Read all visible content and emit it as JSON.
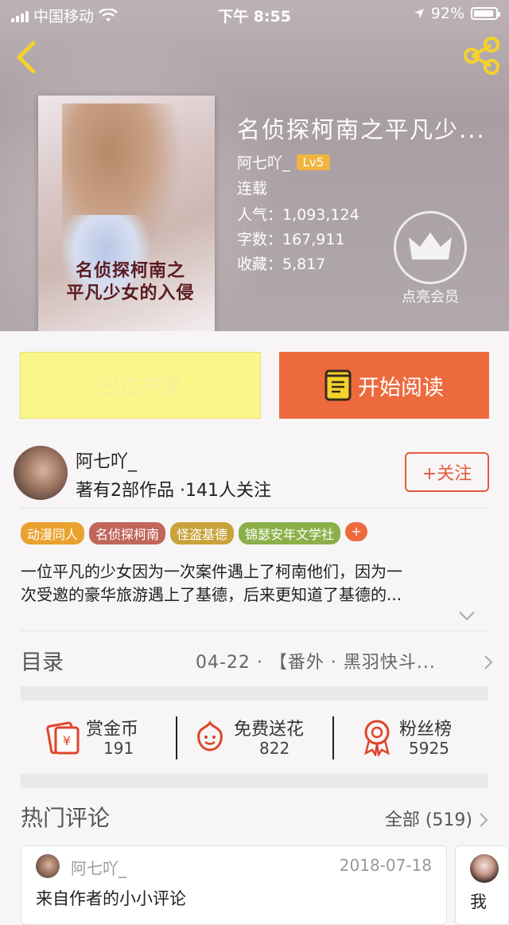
{
  "status_bar": {
    "carrier": "中国移动",
    "time": "下午 8:55",
    "battery": "92%",
    "battery_level": 0.92
  },
  "book": {
    "title": "名侦探柯南之平凡少...",
    "author": "阿七吖_",
    "level": "Lv5",
    "state": "连载",
    "popularity": "人气：1,093,124",
    "word_count": "字数：167,911",
    "favorites": "收藏：5,817",
    "cover_title_line1": "名侦探柯南之",
    "cover_title_line2": "平凡少女的入侵"
  },
  "vip": {
    "label": "点亮会员",
    "icon": "crown-icon"
  },
  "actions": {
    "shelf_label": "已在书架",
    "read_label": "开始阅读"
  },
  "author_info": {
    "name": "阿七吖_",
    "stats": "著有2部作品 ·141人关注",
    "follow_label": "+关注"
  },
  "tags": [
    {
      "label": "动漫同人",
      "color": "#e9a22e"
    },
    {
      "label": "名侦探柯南",
      "color": "#c0665a"
    },
    {
      "label": "怪盗基德",
      "color": "#c8a23a"
    },
    {
      "label": "锦瑟安年文学社",
      "color": "#8bb04a"
    }
  ],
  "tag_add": "+",
  "summary": {
    "line1": "一位平凡的少女因为一次案件遇上了柯南他们，因为一",
    "line2": "次受邀的豪华旅游遇上了基德，后来更知道了基德的..."
  },
  "toc": {
    "title": "目录",
    "latest": "04-22 · 【番外 · 黑羽快斗..."
  },
  "stats": [
    {
      "label": "赏金币",
      "value": "191",
      "icon": "red-envelope-icon"
    },
    {
      "label": "免费送花",
      "value": "822",
      "icon": "flower-icon"
    },
    {
      "label": "粉丝榜",
      "value": "5925",
      "icon": "ribbon-badge-icon"
    }
  ],
  "comments": {
    "title": "热门评论",
    "all_label": "全部 (519)",
    "items": [
      {
        "user": "阿七吖_",
        "date": "2018-07-18",
        "text": "来自作者的小小评论"
      },
      {
        "text": "我"
      }
    ]
  },
  "colors": {
    "accent": "#ed6a3d",
    "shelf_bg": "#fbf68a",
    "follow": "#e45b3c",
    "level_badge": "#f0b540"
  }
}
